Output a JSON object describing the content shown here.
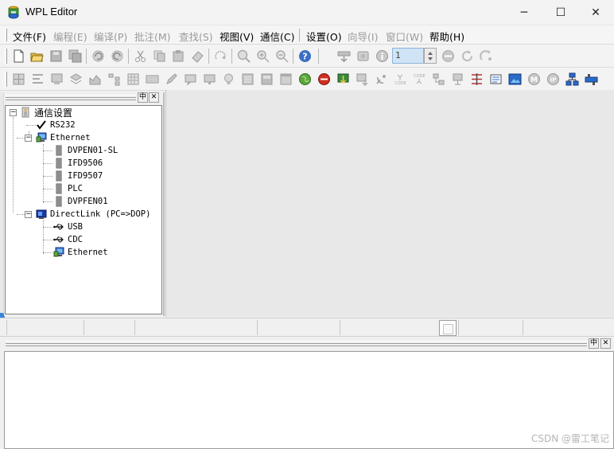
{
  "window": {
    "title": "WPL Editor",
    "controls": {
      "minimize": "─",
      "maximize": "☐",
      "close": "✕"
    }
  },
  "menu": {
    "items": [
      {
        "label": "文件(F)",
        "enabled": true
      },
      {
        "label": "编程(E)",
        "enabled": false
      },
      {
        "label": "编译(P)",
        "enabled": false
      },
      {
        "label": "批注(M)",
        "enabled": false
      },
      {
        "label": "查找(S)",
        "enabled": false
      },
      {
        "label": "视图(V)",
        "enabled": true
      },
      {
        "label": "通信(C)",
        "enabled": true
      },
      {
        "label": "设置(O)",
        "enabled": true
      },
      {
        "label": "向导(I)",
        "enabled": false
      },
      {
        "label": "窗口(W)",
        "enabled": false
      },
      {
        "label": "帮助(H)",
        "enabled": true
      }
    ]
  },
  "toolbar": {
    "zoom_value": "1"
  },
  "tree": {
    "panel_buttons": {
      "pin": "中",
      "close": "✕"
    },
    "root": "通信设置",
    "rs232": "RS232",
    "ethernet": "Ethernet",
    "ethernet_children": [
      "DVPEN01-SL",
      "IFD9506",
      "IFD9507",
      "PLC",
      "DVPFEN01"
    ],
    "directlink": "DirectLink (PC=>DOP)",
    "directlink_children": [
      "USB",
      "CDC",
      "Ethernet"
    ]
  },
  "output_panel": {
    "buttons": {
      "pin": "中",
      "close": "✕"
    }
  },
  "watermark": "CSDN @雷工笔记"
}
